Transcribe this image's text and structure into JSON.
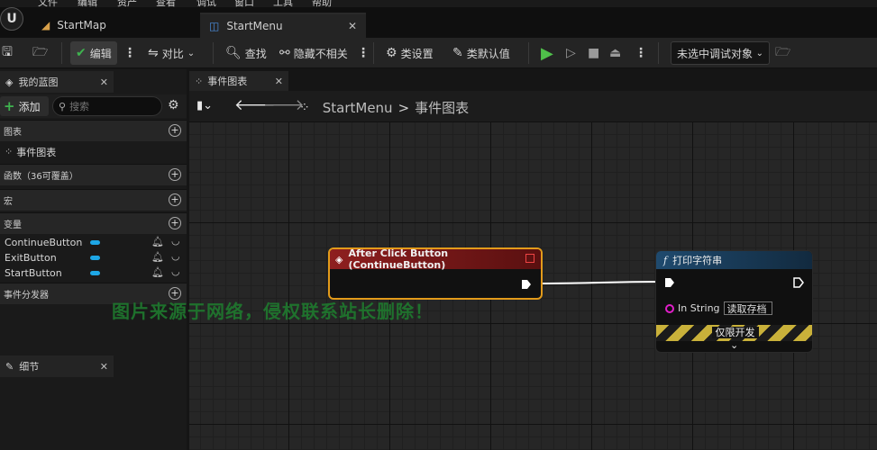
{
  "menubar": {
    "items": [
      "文件",
      "编辑",
      "资产",
      "查看",
      "调试",
      "窗口",
      "工具",
      "帮助"
    ]
  },
  "tabs": [
    {
      "label": "StartMap"
    },
    {
      "label": "StartMenu"
    }
  ],
  "toolbar": {
    "compile_label": "编辑",
    "diff_label": "对比",
    "find_label": "查找",
    "hide_label": "隐藏不相关",
    "class_settings_label": "类设置",
    "class_defaults_label": "类默认值",
    "debug_target": "未选中调试对象"
  },
  "my_blueprint": {
    "tab_label": "我的蓝图",
    "add_label": "添加",
    "search_placeholder": "搜索",
    "sections": {
      "graphs": "图表",
      "event_graph": "事件图表",
      "functions": "函数（36可覆盖）",
      "macros": "宏",
      "variables": "变量",
      "dispatchers": "事件分发器"
    },
    "variables": [
      "ContinueButton",
      "ExitButton",
      "StartButton"
    ]
  },
  "details": {
    "tab_label": "细节"
  },
  "graph": {
    "tab_label": "事件图表",
    "breadcrumb_root": "StartMenu",
    "breadcrumb_sep": ">",
    "breadcrumb_current": "事件图表"
  },
  "event_node": {
    "title": "After Click Button (ContinueButton)"
  },
  "print_node": {
    "title": "打印字符串",
    "in_string_label": "In String",
    "in_string_value": "读取存档",
    "dev_only_label": "仅限开发"
  },
  "watermark": "图片来源于网络，侵权联系站长删除！",
  "colors": {
    "accent_orange": "#e39b1a",
    "event_header": "#8e1f1f",
    "function_header": "#1f4a6e",
    "variable_pill": "#1ea7e6",
    "string_pin": "#e01ec8",
    "play_green": "#4fc04a"
  }
}
